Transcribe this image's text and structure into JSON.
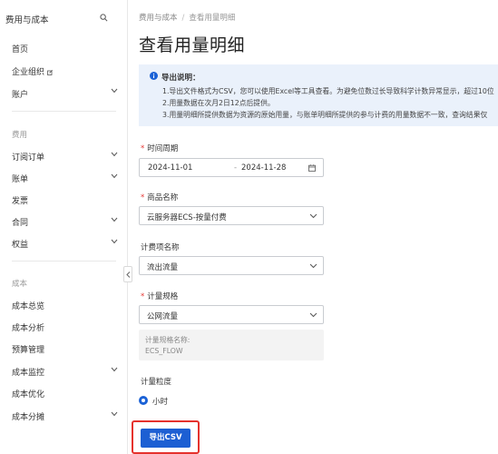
{
  "sidebar": {
    "header": "费用与成本",
    "items_top": [
      {
        "label": "首页"
      },
      {
        "label": "企业组织"
      },
      {
        "label": "账户"
      }
    ],
    "section_fee": "费用",
    "items_fee": [
      {
        "label": "订阅订单"
      },
      {
        "label": "账单"
      },
      {
        "label": "发票"
      },
      {
        "label": "合同"
      },
      {
        "label": "权益"
      }
    ],
    "section_cost": "成本",
    "items_cost": [
      {
        "label": "成本总览"
      },
      {
        "label": "成本分析"
      },
      {
        "label": "预算管理"
      },
      {
        "label": "成本监控"
      },
      {
        "label": "成本优化"
      },
      {
        "label": "成本分摊"
      }
    ]
  },
  "breadcrumb": {
    "root": "费用与成本",
    "sep": "/",
    "current": "查看用量明细"
  },
  "page_title": "查看用量明细",
  "notice": {
    "title": "导出说明：",
    "lines": [
      "1.导出文件格式为CSV，您可以使用Excel等工具查看。为避免位数过长导致科学计数异常显示，超过10位",
      "2.用量数据在次月2日12点后提供。",
      "3.用量明细所提供数据为资源的原始用量，与账单明细所提供的参与计费的用量数据不一致，查询结果仅"
    ]
  },
  "form": {
    "time_period": {
      "label": "时间周期",
      "start": "2024-11-01",
      "dash": "-",
      "end": "2024-11-28"
    },
    "product": {
      "label": "商品名称",
      "value": "云服务器ECS-按量付费"
    },
    "billing_item": {
      "label": "计费项名称",
      "value": "流出流量"
    },
    "spec": {
      "label": "计量规格",
      "value": "公网流量"
    },
    "spec_name": {
      "label": "计量规格名称:",
      "value": "ECS_FLOW"
    },
    "granularity": {
      "label": "计量粒度",
      "option": "小时",
      "selected": true
    }
  },
  "export_button": "导出CSV",
  "colors": {
    "primary": "#1c5fd3",
    "highlight": "#e5322d",
    "notice_bg": "#eaf1fb"
  }
}
